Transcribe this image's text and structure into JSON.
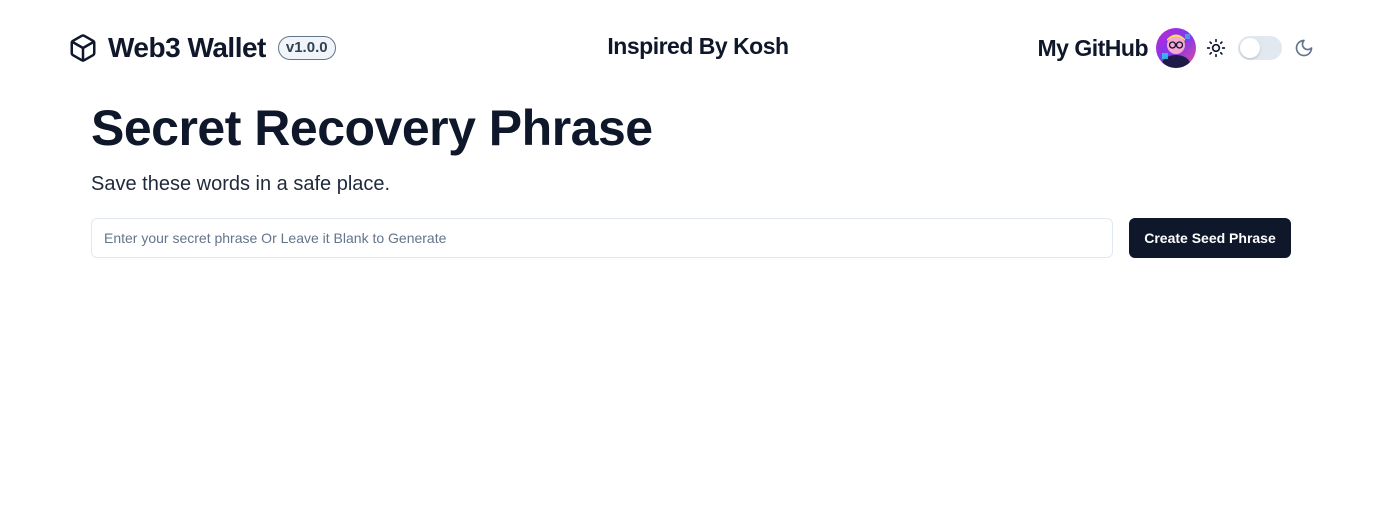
{
  "header": {
    "brand_title": "Web3 Wallet",
    "version": "v1.0.0",
    "brand_icon": "cube-icon",
    "center_title": "Inspired By Kosh",
    "github_label": "My GitHub",
    "avatar_icon": "avatar",
    "light_icon": "sun-icon",
    "dark_icon": "moon-icon",
    "theme_dark_enabled": false
  },
  "main": {
    "title": "Secret Recovery Phrase",
    "subtitle": "Save these words in a safe place.",
    "input": {
      "value": "",
      "placeholder": "Enter your secret phrase Or Leave it Blank to Generate"
    },
    "create_button_label": "Create Seed Phrase"
  },
  "colors": {
    "primary": "#0f172a",
    "border": "#e2e8f0",
    "muted_text": "#64748b",
    "background": "#ffffff"
  }
}
